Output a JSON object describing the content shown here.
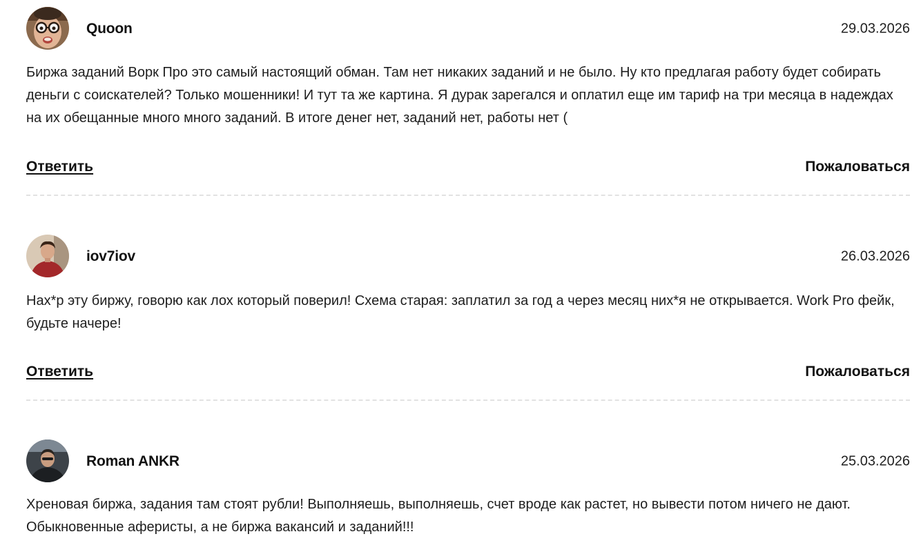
{
  "comments": [
    {
      "author": "Quoon",
      "date": "29.03.2026",
      "avatar": "avatar-glasses-man",
      "text": "Биржа заданий Ворк Про это самый настоящий обман. Там нет никаких заданий и не было. Ну кто предлагая работу будет собирать деньги с соискателей? Только мошенники! И тут та же картина. Я дурак зарегался и оплатил еще им тариф на три месяца в надеждах на их обещанные много много заданий. В итоге денег нет, заданий нет, работы нет (",
      "reply_label": "Ответить",
      "report_label": "Пожаловаться"
    },
    {
      "author": "iov7iov",
      "date": "26.03.2026",
      "avatar": "avatar-red-hoodie",
      "text": "Нах*р эту биржу, говорю как лох который поверил! Схема старая: заплатил за год а через месяц них*я не открывается. Work Pro фейк, будьте начере!",
      "reply_label": "Ответить",
      "report_label": "Пожаловаться"
    },
    {
      "author": "Roman ANKR",
      "date": "25.03.2026",
      "avatar": "avatar-car-selfie",
      "text": "Хреновая биржа, задания там стоят рубли! Выполняешь, выполняешь, счет вроде как растет, но вывести потом ничего не дают. Обыкновенные аферисты, а не биржа вакансий и заданий!!!"
    }
  ],
  "colors": {
    "text": "#1e1e1e",
    "divider": "#e2e2e2",
    "background": "#ffffff"
  }
}
